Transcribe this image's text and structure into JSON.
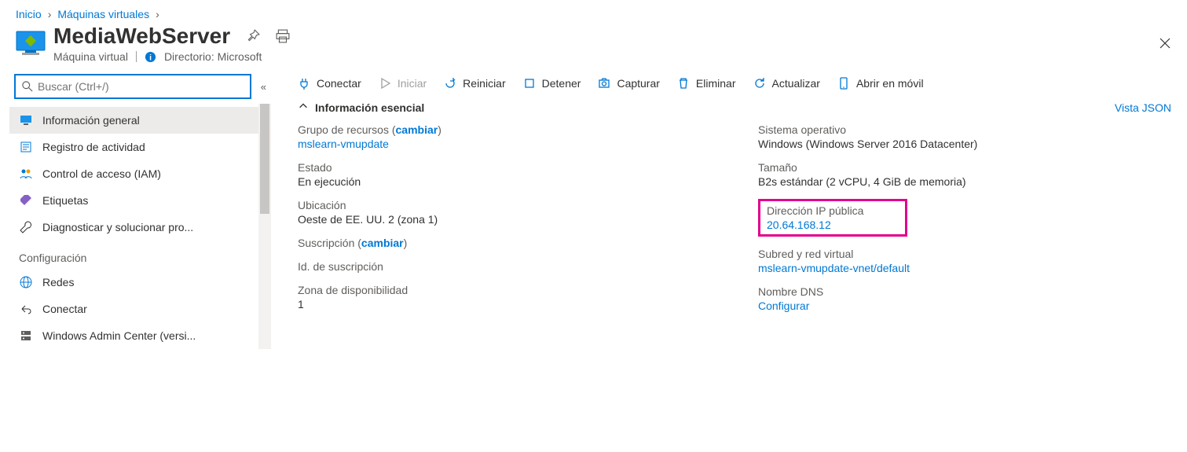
{
  "breadcrumb": {
    "home": "Inicio",
    "vms": "Máquinas virtuales"
  },
  "header": {
    "title": "MediaWebServer",
    "type": "Máquina virtual",
    "directory_label": "Directorio: Microsoft"
  },
  "sidebar": {
    "search_placeholder": "Buscar (Ctrl+/)",
    "items": {
      "overview": "Información general",
      "activity": "Registro de actividad",
      "iam": "Control de acceso (IAM)",
      "tags": "Etiquetas",
      "diagnose": "Diagnosticar y solucionar pro..."
    },
    "section_config": "Configuración",
    "config_items": {
      "networking": "Redes",
      "connect": "Conectar",
      "wac": "Windows Admin Center (versi..."
    }
  },
  "toolbar": {
    "connect": "Conectar",
    "start": "Iniciar",
    "restart": "Reiniciar",
    "stop": "Detener",
    "capture": "Capturar",
    "delete": "Eliminar",
    "refresh": "Actualizar",
    "open_mobile": "Abrir en móvil"
  },
  "essentials": {
    "header": "Información esencial",
    "json_view": "Vista JSON",
    "left": {
      "rg_label": "Grupo de recursos (",
      "rg_change": "cambiar",
      "rg_close": ")",
      "rg_value": "mslearn-vmupdate",
      "status_label": "Estado",
      "status_value": "En ejecución",
      "location_label": "Ubicación",
      "location_value": "Oeste de EE. UU. 2 (zona 1)",
      "sub_label": "Suscripción (",
      "sub_change": "cambiar",
      "sub_close": ")",
      "subid_label": "Id. de suscripción",
      "zone_label": "Zona de disponibilidad",
      "zone_value": "1"
    },
    "right": {
      "os_label": "Sistema operativo",
      "os_value": "Windows (Windows Server 2016 Datacenter)",
      "size_label": "Tamaño",
      "size_value": "B2s estándar (2 vCPU, 4 GiB de memoria)",
      "ip_label": "Dirección IP pública",
      "ip_value": "20.64.168.12",
      "vnet_label": "Subred y red virtual",
      "vnet_value": "mslearn-vmupdate-vnet/default",
      "dns_label": "Nombre DNS",
      "dns_value": "Configurar"
    }
  }
}
